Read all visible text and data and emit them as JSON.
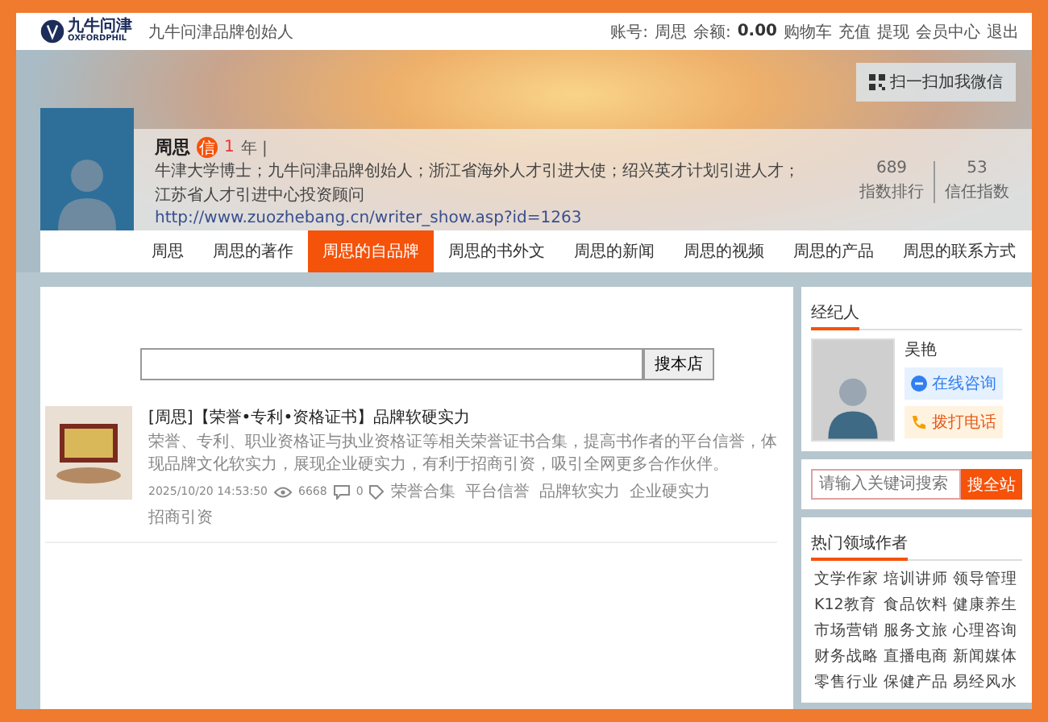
{
  "top_bar": {
    "logo": {
      "name": "九牛问津",
      "subtitle": "OXFORDPHIL"
    },
    "tagline": "九牛问津品牌创始人",
    "account_label": "账号:",
    "account_name": "周思",
    "balance_label": "余额:",
    "balance": "0.00",
    "links": [
      "购物车",
      "充值",
      "提现",
      "会员中心",
      "退出"
    ]
  },
  "banner": {
    "wechat_button": "扫一扫加我微信",
    "profile": {
      "name": "周思",
      "badge": "信",
      "years": "1",
      "years_unit": "年 |",
      "bio": "牛津大学博士；九牛问津品牌创始人；浙江省海外人才引进大使；绍兴英才计划引进人才；江苏省人才引进中心投资顾问",
      "url": "http://www.zuozhebang.cn/writer_show.asp?id=1263",
      "stats": [
        {
          "value": "689",
          "label": "指数排行"
        },
        {
          "value": "53",
          "label": "信任指数"
        }
      ]
    }
  },
  "nav": [
    {
      "label": "周思",
      "selected": false
    },
    {
      "label": "周思的著作",
      "selected": false
    },
    {
      "label": "周思的自品牌",
      "selected": true
    },
    {
      "label": "周思的书外文",
      "selected": false
    },
    {
      "label": "周思的新闻",
      "selected": false
    },
    {
      "label": "周思的视频",
      "selected": false
    },
    {
      "label": "周思的产品",
      "selected": false
    },
    {
      "label": "周思的联系方式",
      "selected": false
    }
  ],
  "shop_search": {
    "button": "搜本店"
  },
  "articles": [
    {
      "title": "[周思]【荣誉•专利•资格证书】品牌软硬实力",
      "summary": "荣誉、专利、职业资格证与执业资格证等相关荣誉证书合集，提高书作者的平台信誉，体现品牌文化软实力，展现企业硬实力，有利于招商引资，吸引全网更多合作伙伴。",
      "date": "2025/10/20 14:53:50",
      "views": "6668",
      "comments": "0",
      "tags": [
        "荣誉合集",
        "平台信誉",
        "品牌软实力",
        "企业硬实力",
        "招商引资"
      ]
    }
  ],
  "agent": {
    "title": "经纪人",
    "name": "吴艳",
    "buttons": [
      {
        "kind": "chat",
        "label": "在线咨询"
      },
      {
        "kind": "phone",
        "label": "拨打电话"
      }
    ]
  },
  "site_search": {
    "placeholder": "请输入关键词搜索",
    "button": "搜全站"
  },
  "hot_authors": {
    "title": "热门领域作者",
    "tags": [
      "文学作家",
      "培训讲师",
      "领导管理",
      "K12教育",
      "食品饮料",
      "健康养生",
      "市场营销",
      "服务文旅",
      "心理咨询",
      "财务战略",
      "直播电商",
      "新闻媒体",
      "零售行业",
      "保健产品",
      "易经风水"
    ]
  }
}
